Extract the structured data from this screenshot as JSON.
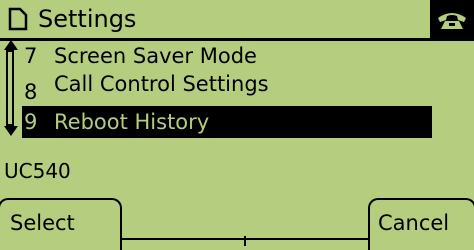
{
  "header": {
    "title": "Settings",
    "folder_icon": "folder-icon",
    "phone_icon": "phone-handset-icon"
  },
  "menu": {
    "items": [
      {
        "number": "7",
        "label": "Screen Saver Mode",
        "selected": false
      },
      {
        "number": "8",
        "label": "Call Control Settings",
        "selected": false
      },
      {
        "number": "9",
        "label": "Reboot History",
        "selected": true
      }
    ]
  },
  "status": {
    "text": "UC540"
  },
  "softkeys": {
    "select_label": "Select",
    "cancel_label": "Cancel"
  },
  "colors": {
    "screen_background": "#b5cd7f",
    "foreground": "#000000"
  }
}
